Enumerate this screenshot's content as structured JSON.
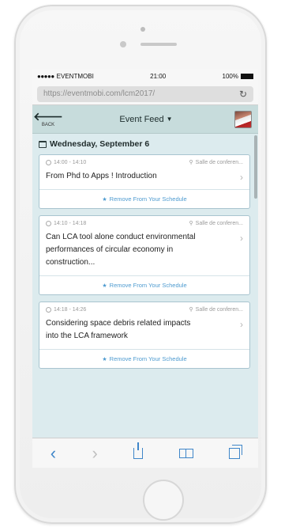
{
  "status_bar": {
    "carrier": "EVENTMOBI",
    "signal": "●●●●●",
    "time": "21:00",
    "battery": "100%",
    "battery_level": 1.0
  },
  "browser": {
    "url": "https://eventmobi.com/lcm2017/",
    "reload_icon": "reload-icon"
  },
  "header": {
    "back_label": "BACK",
    "title": "Event Feed",
    "back_icon": "arrow-left-icon",
    "caret_icon": "caret-down-icon"
  },
  "schedule": {
    "date": "Wednesday, September 6",
    "sessions": [
      {
        "time": "14:00 - 14:10",
        "room": "Salle de conferen...",
        "title": "From Phd to Apps ! Introduction",
        "action": "Remove From Your Schedule"
      },
      {
        "time": "14:10 - 14:18",
        "room": "Salle de conferen...",
        "title": "Can LCA tool alone conduct environmental performances of circular economy in construction...",
        "action": "Remove From Your Schedule"
      },
      {
        "time": "14:18 - 14:26",
        "room": "Salle de conferen...",
        "title": "Considering space debris related impacts into the LCA framework",
        "action": "Remove From Your Schedule"
      }
    ]
  },
  "toolbar": {
    "back": "‹",
    "forward": "›"
  },
  "colors": {
    "header_bg": "#c7dcdc",
    "content_bg": "#dcebee",
    "accent": "#4e9bd0",
    "toolbar_accent": "#3f86c9"
  }
}
